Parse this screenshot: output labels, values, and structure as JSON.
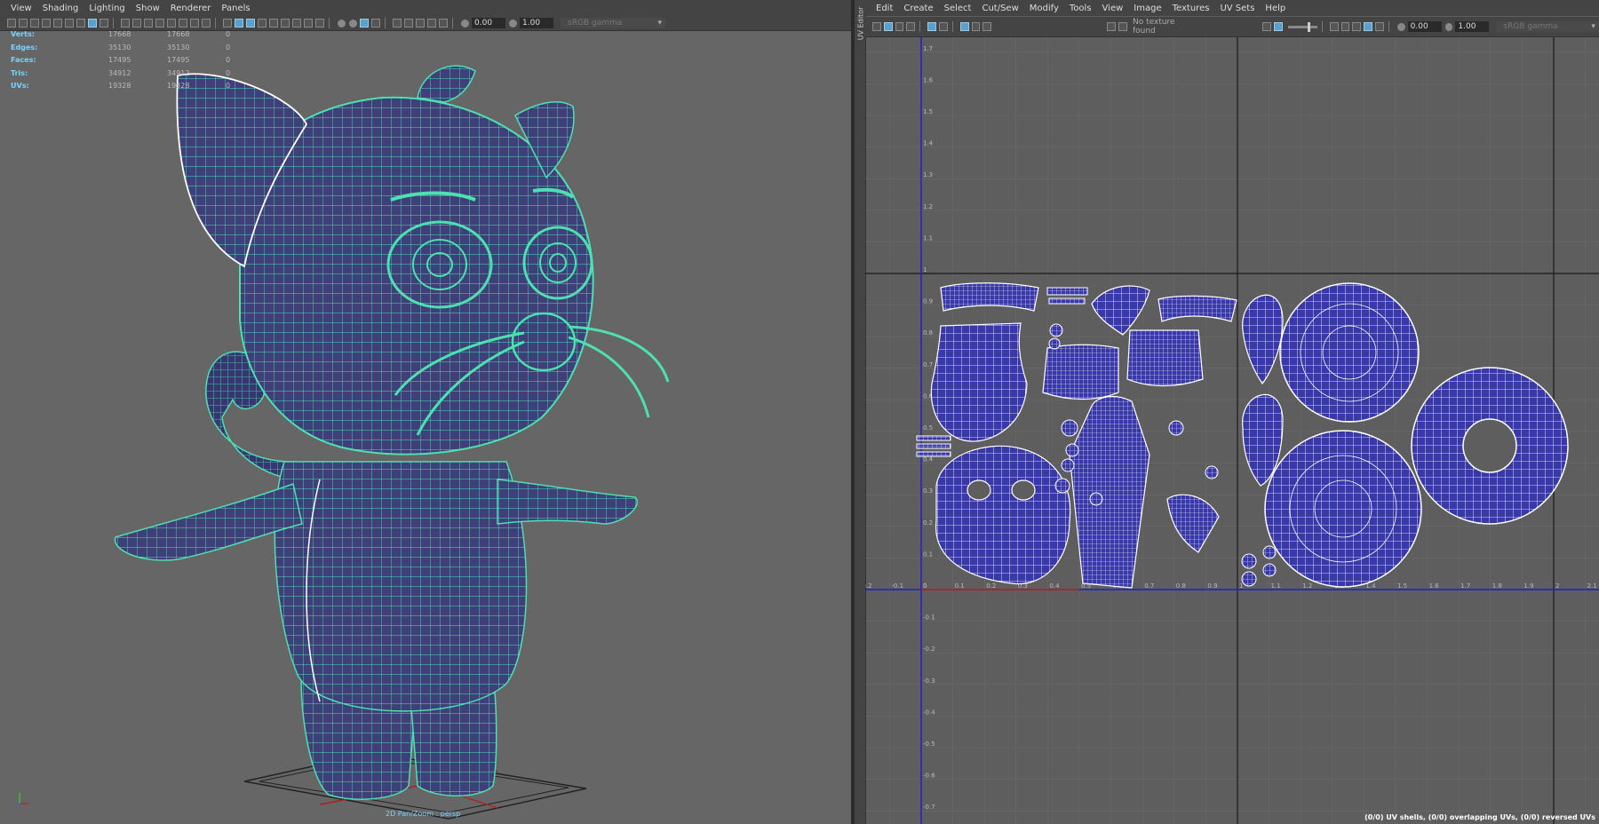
{
  "left_panel": {
    "menu": [
      "View",
      "Shading",
      "Lighting",
      "Show",
      "Renderer",
      "Panels"
    ],
    "toolbar": {
      "field1": "0.00",
      "field2": "1.00",
      "color_space": "sRGB gamma"
    },
    "hud": [
      {
        "label": "Verts:",
        "v1": "17668",
        "v2": "17668",
        "v3": "0"
      },
      {
        "label": "Edges:",
        "v1": "35130",
        "v2": "35130",
        "v3": "0"
      },
      {
        "label": "Faces:",
        "v1": "17495",
        "v2": "17495",
        "v3": "0"
      },
      {
        "label": "Tris:",
        "v1": "34912",
        "v2": "34912",
        "v3": "0"
      },
      {
        "label": "UVs:",
        "v1": "19328",
        "v2": "19328",
        "v3": "0"
      }
    ],
    "camera_label": "2D Pan/Zoom : persp"
  },
  "right_panel": {
    "side_tab": "UV Editor",
    "menu": [
      "Edit",
      "Create",
      "Select",
      "Cut/Sew",
      "Modify",
      "Tools",
      "View",
      "Image",
      "Textures",
      "UV Sets",
      "Help"
    ],
    "toolbar": {
      "texture_status": "No texture found",
      "field1": "0.00",
      "field2": "1.00",
      "color_space": "sRGB gamma"
    },
    "v_ticks": [
      "1.7",
      "1.6",
      "1.5",
      "1.4",
      "1.3",
      "1.2",
      "1.1",
      "1",
      "0.9",
      "0.8",
      "0.7",
      "0.6",
      "0.5",
      "0.4",
      "0.3",
      "0.2",
      "0.1",
      "0",
      "-0.1",
      "-0.2",
      "-0.3",
      "-0.4",
      "-0.5",
      "-0.6",
      "-0.7"
    ],
    "h_ticks": [
      "-0.2",
      "-0.1",
      "0",
      "0.1",
      "0.2",
      "0.3",
      "0.4",
      "0.5",
      "0.6",
      "0.7",
      "0.8",
      "0.9",
      "1",
      "1.1",
      "1.2",
      "1.3",
      "1.4",
      "1.5",
      "1.6",
      "1.7",
      "1.8",
      "1.9",
      "2",
      "2.1"
    ],
    "status": "(0/0) UV shells, (0/0) overlapping UVs, (0/0) reversed UVs"
  },
  "colors": {
    "wire": "#4ee0b0",
    "mesh_fill": "#3f3f7a",
    "uv_fill": "#3838a8",
    "axis_red": "#c02020",
    "axis_blue": "#2020c8",
    "hud_label": "#7ad3ff"
  }
}
